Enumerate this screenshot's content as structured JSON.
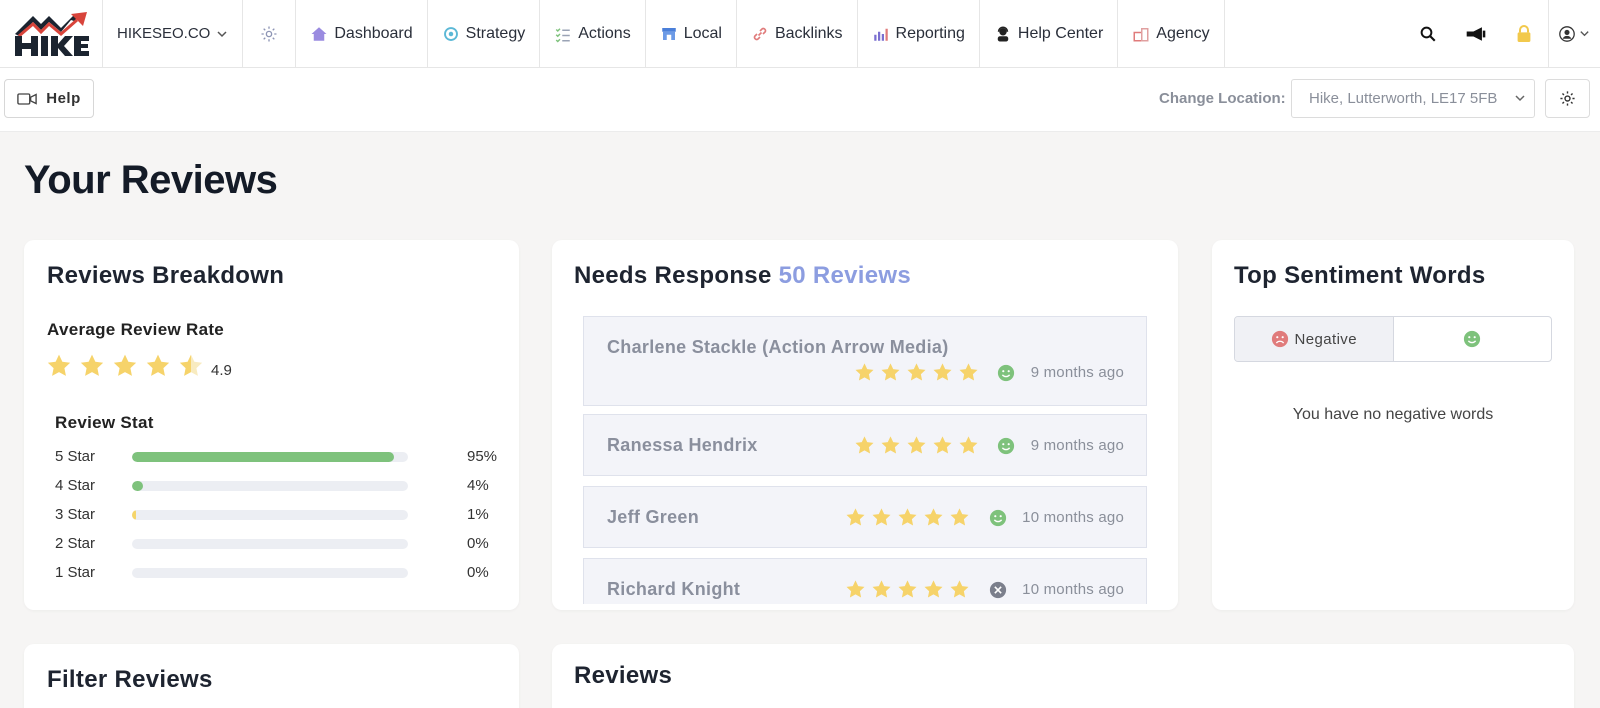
{
  "brand": {
    "logo_text": "HIKE"
  },
  "topnav": {
    "account": "HIKESEO.CO",
    "items": [
      {
        "label": "Dashboard",
        "icon": "home-icon"
      },
      {
        "label": "Strategy",
        "icon": "strategy-icon"
      },
      {
        "label": "Actions",
        "icon": "checklist-icon"
      },
      {
        "label": "Local",
        "icon": "store-icon"
      },
      {
        "label": "Backlinks",
        "icon": "link-icon"
      },
      {
        "label": "Reporting",
        "icon": "bar-chart-icon"
      },
      {
        "label": "Help Center",
        "icon": "support-agent-icon"
      },
      {
        "label": "Agency",
        "icon": "agency-icon"
      }
    ]
  },
  "subbar": {
    "help_label": "Help",
    "location_label": "Change Location:",
    "location_value": "Hike, Lutterworth, LE17 5FB"
  },
  "page": {
    "title": "Your Reviews"
  },
  "breakdown": {
    "title": "Reviews Breakdown",
    "avg_label": "Average Review Rate",
    "avg_value": "4.9",
    "avg_rating": 4.9,
    "stat_title": "Review Stat",
    "rows": [
      {
        "label": "5 Star",
        "pct": "95%",
        "value": 0.95,
        "color": "#7ec27c"
      },
      {
        "label": "4 Star",
        "pct": "4%",
        "value": 0.04,
        "color": "#7ec27c"
      },
      {
        "label": "3 Star",
        "pct": "1%",
        "value": 0.01,
        "color": "#f5d56a"
      },
      {
        "label": "2 Star",
        "pct": "0%",
        "value": 0,
        "color": "#e07b7b"
      },
      {
        "label": "1 Star",
        "pct": "0%",
        "value": 0,
        "color": "#e07b7b"
      }
    ]
  },
  "needs_response": {
    "title": "Needs Response",
    "count_label": "50 Reviews",
    "items": [
      {
        "name": "Charlene Stackle (Action Arrow Media)",
        "stars": 5,
        "sentiment": "positive",
        "time": "9 months ago"
      },
      {
        "name": "Ranessa Hendrix",
        "stars": 5,
        "sentiment": "positive",
        "time": "9 months ago"
      },
      {
        "name": "Jeff Green",
        "stars": 5,
        "sentiment": "positive",
        "time": "10 months ago"
      },
      {
        "name": "Richard Knight",
        "stars": 5,
        "sentiment": "neutral",
        "time": "10 months ago"
      }
    ]
  },
  "sentiment": {
    "title": "Top Sentiment Words",
    "tab_negative": "Negative",
    "empty_message": "You have no negative words"
  },
  "filter": {
    "title": "Filter Reviews"
  },
  "reviews": {
    "title": "Reviews"
  },
  "colors": {
    "star": "#f6d36a",
    "accent": "#8c9de0",
    "positive": "#7ec27c",
    "negative": "#e07b7b"
  }
}
